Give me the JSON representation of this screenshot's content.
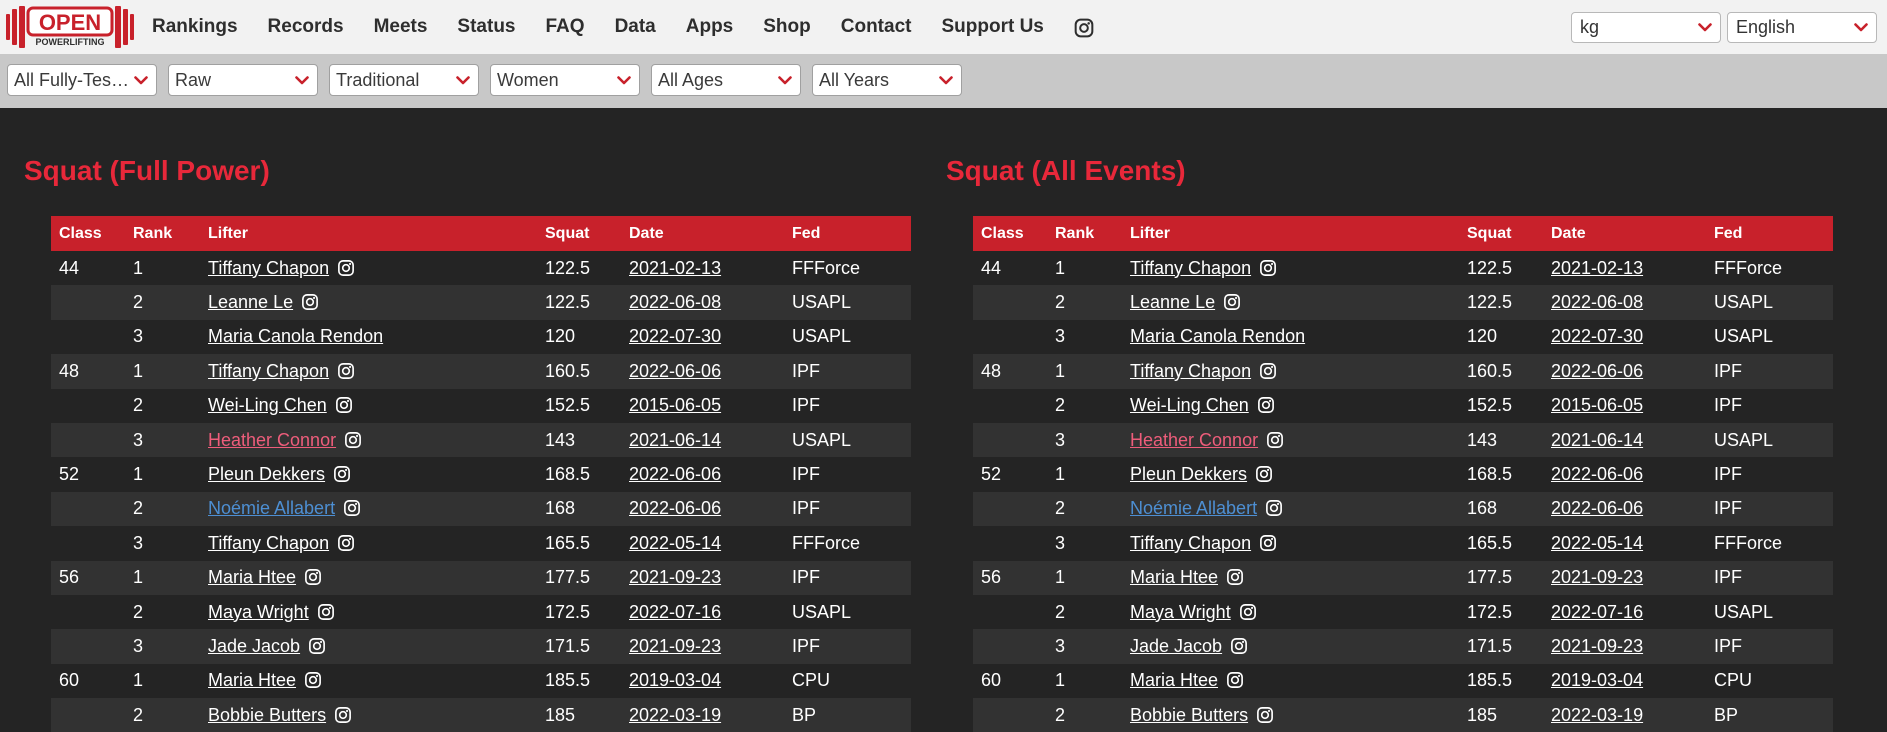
{
  "brand": {
    "logo_word": "OPEN",
    "logo_sub": "POWERLIFTING",
    "accent": "#c8212b",
    "title_color": "#e8283a"
  },
  "nav": {
    "links": [
      "Rankings",
      "Records",
      "Meets",
      "Status",
      "FAQ",
      "Data",
      "Apps",
      "Shop",
      "Contact",
      "Support Us"
    ],
    "instagram_icon": "instagram-icon"
  },
  "units_select": {
    "value": "kg"
  },
  "language_select": {
    "value": "English"
  },
  "filters": [
    {
      "value": "All Fully-Tes…"
    },
    {
      "value": "Raw"
    },
    {
      "value": "Traditional"
    },
    {
      "value": "Women"
    },
    {
      "value": "All Ages"
    },
    {
      "value": "All Years"
    }
  ],
  "tables": [
    {
      "title": "Squat (Full Power)",
      "columns": [
        "Class",
        "Rank",
        "Lifter",
        "Squat",
        "Date",
        "Fed"
      ],
      "rows": [
        {
          "class": "44",
          "rank": "1",
          "lifter": "Tiffany Chapon",
          "style": "",
          "ig": true,
          "squat": "122.5",
          "date": "2021-02-13",
          "fed": "FFForce"
        },
        {
          "class": "",
          "rank": "2",
          "lifter": "Leanne Le",
          "style": "",
          "ig": true,
          "squat": "122.5",
          "date": "2022-06-08",
          "fed": "USAPL"
        },
        {
          "class": "",
          "rank": "3",
          "lifter": "Maria Canola Rendon",
          "style": "",
          "ig": false,
          "squat": "120",
          "date": "2022-07-30",
          "fed": "USAPL"
        },
        {
          "class": "48",
          "rank": "1",
          "lifter": "Tiffany Chapon",
          "style": "",
          "ig": true,
          "squat": "160.5",
          "date": "2022-06-06",
          "fed": "IPF"
        },
        {
          "class": "",
          "rank": "2",
          "lifter": "Wei-Ling Chen",
          "style": "",
          "ig": true,
          "squat": "152.5",
          "date": "2015-06-05",
          "fed": "IPF"
        },
        {
          "class": "",
          "rank": "3",
          "lifter": "Heather Connor",
          "style": "pink",
          "ig": true,
          "squat": "143",
          "date": "2021-06-14",
          "fed": "USAPL"
        },
        {
          "class": "52",
          "rank": "1",
          "lifter": "Pleun Dekkers",
          "style": "",
          "ig": true,
          "squat": "168.5",
          "date": "2022-06-06",
          "fed": "IPF"
        },
        {
          "class": "",
          "rank": "2",
          "lifter": "Noémie Allabert",
          "style": "blue",
          "ig": true,
          "squat": "168",
          "date": "2022-06-06",
          "fed": "IPF"
        },
        {
          "class": "",
          "rank": "3",
          "lifter": "Tiffany Chapon",
          "style": "",
          "ig": true,
          "squat": "165.5",
          "date": "2022-05-14",
          "fed": "FFForce"
        },
        {
          "class": "56",
          "rank": "1",
          "lifter": "Maria Htee",
          "style": "",
          "ig": true,
          "squat": "177.5",
          "date": "2021-09-23",
          "fed": "IPF"
        },
        {
          "class": "",
          "rank": "2",
          "lifter": "Maya Wright",
          "style": "",
          "ig": true,
          "squat": "172.5",
          "date": "2022-07-16",
          "fed": "USAPL"
        },
        {
          "class": "",
          "rank": "3",
          "lifter": "Jade Jacob",
          "style": "",
          "ig": true,
          "squat": "171.5",
          "date": "2021-09-23",
          "fed": "IPF"
        },
        {
          "class": "60",
          "rank": "1",
          "lifter": "Maria Htee",
          "style": "",
          "ig": true,
          "squat": "185.5",
          "date": "2019-03-04",
          "fed": "CPU"
        },
        {
          "class": "",
          "rank": "2",
          "lifter": "Bobbie Butters",
          "style": "",
          "ig": true,
          "squat": "185",
          "date": "2022-03-19",
          "fed": "BP"
        }
      ]
    },
    {
      "title": "Squat (All Events)",
      "columns": [
        "Class",
        "Rank",
        "Lifter",
        "Squat",
        "Date",
        "Fed"
      ],
      "rows": [
        {
          "class": "44",
          "rank": "1",
          "lifter": "Tiffany Chapon",
          "style": "",
          "ig": true,
          "squat": "122.5",
          "date": "2021-02-13",
          "fed": "FFForce"
        },
        {
          "class": "",
          "rank": "2",
          "lifter": "Leanne Le",
          "style": "",
          "ig": true,
          "squat": "122.5",
          "date": "2022-06-08",
          "fed": "USAPL"
        },
        {
          "class": "",
          "rank": "3",
          "lifter": "Maria Canola Rendon",
          "style": "",
          "ig": false,
          "squat": "120",
          "date": "2022-07-30",
          "fed": "USAPL"
        },
        {
          "class": "48",
          "rank": "1",
          "lifter": "Tiffany Chapon",
          "style": "",
          "ig": true,
          "squat": "160.5",
          "date": "2022-06-06",
          "fed": "IPF"
        },
        {
          "class": "",
          "rank": "2",
          "lifter": "Wei-Ling Chen",
          "style": "",
          "ig": true,
          "squat": "152.5",
          "date": "2015-06-05",
          "fed": "IPF"
        },
        {
          "class": "",
          "rank": "3",
          "lifter": "Heather Connor",
          "style": "pink",
          "ig": true,
          "squat": "143",
          "date": "2021-06-14",
          "fed": "USAPL"
        },
        {
          "class": "52",
          "rank": "1",
          "lifter": "Pleun Dekkers",
          "style": "",
          "ig": true,
          "squat": "168.5",
          "date": "2022-06-06",
          "fed": "IPF"
        },
        {
          "class": "",
          "rank": "2",
          "lifter": "Noémie Allabert",
          "style": "blue",
          "ig": true,
          "squat": "168",
          "date": "2022-06-06",
          "fed": "IPF"
        },
        {
          "class": "",
          "rank": "3",
          "lifter": "Tiffany Chapon",
          "style": "",
          "ig": true,
          "squat": "165.5",
          "date": "2022-05-14",
          "fed": "FFForce"
        },
        {
          "class": "56",
          "rank": "1",
          "lifter": "Maria Htee",
          "style": "",
          "ig": true,
          "squat": "177.5",
          "date": "2021-09-23",
          "fed": "IPF"
        },
        {
          "class": "",
          "rank": "2",
          "lifter": "Maya Wright",
          "style": "",
          "ig": true,
          "squat": "172.5",
          "date": "2022-07-16",
          "fed": "USAPL"
        },
        {
          "class": "",
          "rank": "3",
          "lifter": "Jade Jacob",
          "style": "",
          "ig": true,
          "squat": "171.5",
          "date": "2021-09-23",
          "fed": "IPF"
        },
        {
          "class": "60",
          "rank": "1",
          "lifter": "Maria Htee",
          "style": "",
          "ig": true,
          "squat": "185.5",
          "date": "2019-03-04",
          "fed": "CPU"
        },
        {
          "class": "",
          "rank": "2",
          "lifter": "Bobbie Butters",
          "style": "",
          "ig": true,
          "squat": "185",
          "date": "2022-03-19",
          "fed": "BP"
        }
      ]
    }
  ]
}
